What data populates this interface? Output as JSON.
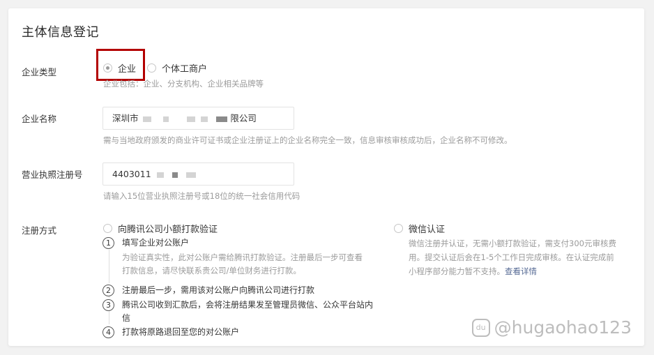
{
  "form": {
    "title": "主体信息登记",
    "enterprise_type": {
      "label": "企业类型",
      "options": [
        {
          "label": "企业",
          "checked": true
        },
        {
          "label": "个体工商户",
          "checked": false
        }
      ],
      "hint": "企业包括：企业、分支机构、企业相关品牌等"
    },
    "enterprise_name": {
      "label": "企业名称",
      "value_prefix": "深圳市",
      "value_suffix": "限公司",
      "hint": "需与当地政府颁发的商业许可证书或企业注册证上的企业名称完全一致，信息审核审核成功后，企业名称不可修改。"
    },
    "license_number": {
      "label": "营业执照注册号",
      "value_prefix": "4403011",
      "hint": "请输入15位营业执照注册号或18位的统一社会信用代码"
    },
    "registration_method": {
      "label": "注册方式",
      "option_bank": {
        "label": "向腾讯公司小额打款验证",
        "steps": [
          {
            "num": "1",
            "title": "填写企业对公账户",
            "desc_line1": "为验证真实性，此对公账户需给腾讯打款验证。注册最后一步可查看",
            "desc_line2": "打款信息，请尽快联系贵公司/单位财务进行打款。"
          },
          {
            "num": "2",
            "title": "注册最后一步，需用该对公账户向腾讯公司进行打款"
          },
          {
            "num": "3",
            "title_line1": "腾讯公司收到汇款后，会将注册结果发至管理员微信、公众平台站内",
            "title_line2": "信"
          },
          {
            "num": "4",
            "title": "打款将原路退回至您的对公账户"
          }
        ]
      },
      "option_wechat": {
        "label": "微信认证",
        "desc_line1": "微信注册并认证，无需小额打款验证，需支付300元审核费",
        "desc_line2": "用。提交认证后会在1-5个工作日完成审核。在认证完成前",
        "desc_line3": "小程序部分能力暂不支持。",
        "link": "查看详情"
      }
    }
  },
  "watermark": {
    "icon_text": "du",
    "text": "@hugaohao123"
  }
}
